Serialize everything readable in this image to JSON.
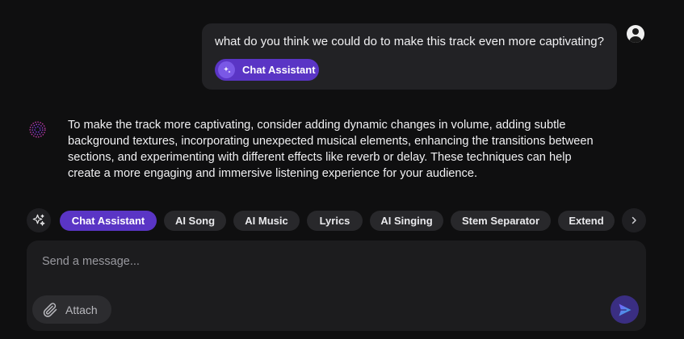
{
  "user_message": {
    "text": "what do you think we could do to make this track even more captivating?",
    "mode_chip": "Chat Assistant"
  },
  "assistant_message": {
    "text": "To make the track more captivating, consider adding dynamic changes in volume, adding subtle background textures, incorporating unexpected musical elements, enhancing the transitions between sections, and experimenting with different effects like reverb or delay. These techniques can help create a more engaging and immersive listening experience for your audience."
  },
  "tools": [
    {
      "label": "Chat Assistant",
      "active": true
    },
    {
      "label": "AI Song",
      "active": false
    },
    {
      "label": "AI Music",
      "active": false
    },
    {
      "label": "Lyrics",
      "active": false
    },
    {
      "label": "AI Singing",
      "active": false
    },
    {
      "label": "Stem Separator",
      "active": false
    },
    {
      "label": "Extend",
      "active": false
    }
  ],
  "composer": {
    "placeholder": "Send a message...",
    "attach_label": "Attach"
  },
  "icons": {
    "tools_button": "sparkles-icon",
    "next_button": "chevron-right-icon",
    "attach": "paperclip-icon",
    "send": "send-icon",
    "user_avatar": "user-avatar-icon",
    "assistant_avatar": "assistant-orb-icon"
  },
  "colors": {
    "accent": "#5a35c5",
    "background": "#0f0f10",
    "bubble": "#222225"
  }
}
